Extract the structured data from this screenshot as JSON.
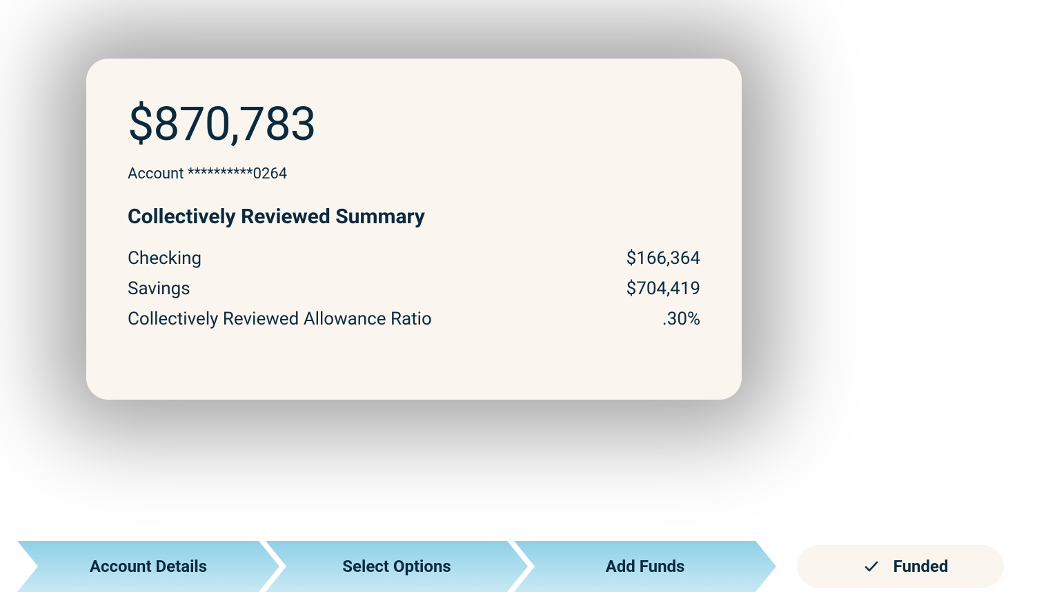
{
  "card": {
    "balance": "$870,783",
    "account_number": "Account **********0264",
    "summary_title": "Collectively Reviewed Summary",
    "rows": [
      {
        "label": "Checking",
        "value": "$166,364"
      },
      {
        "label": "Savings",
        "value": "$704,419"
      },
      {
        "label": "Collectively Reviewed Allowance Ratio",
        "value": ".30%"
      }
    ]
  },
  "stepper": {
    "steps": [
      {
        "label": "Account Details"
      },
      {
        "label": "Select Options"
      },
      {
        "label": "Add Funds"
      }
    ],
    "final": {
      "label": "Funded"
    }
  }
}
